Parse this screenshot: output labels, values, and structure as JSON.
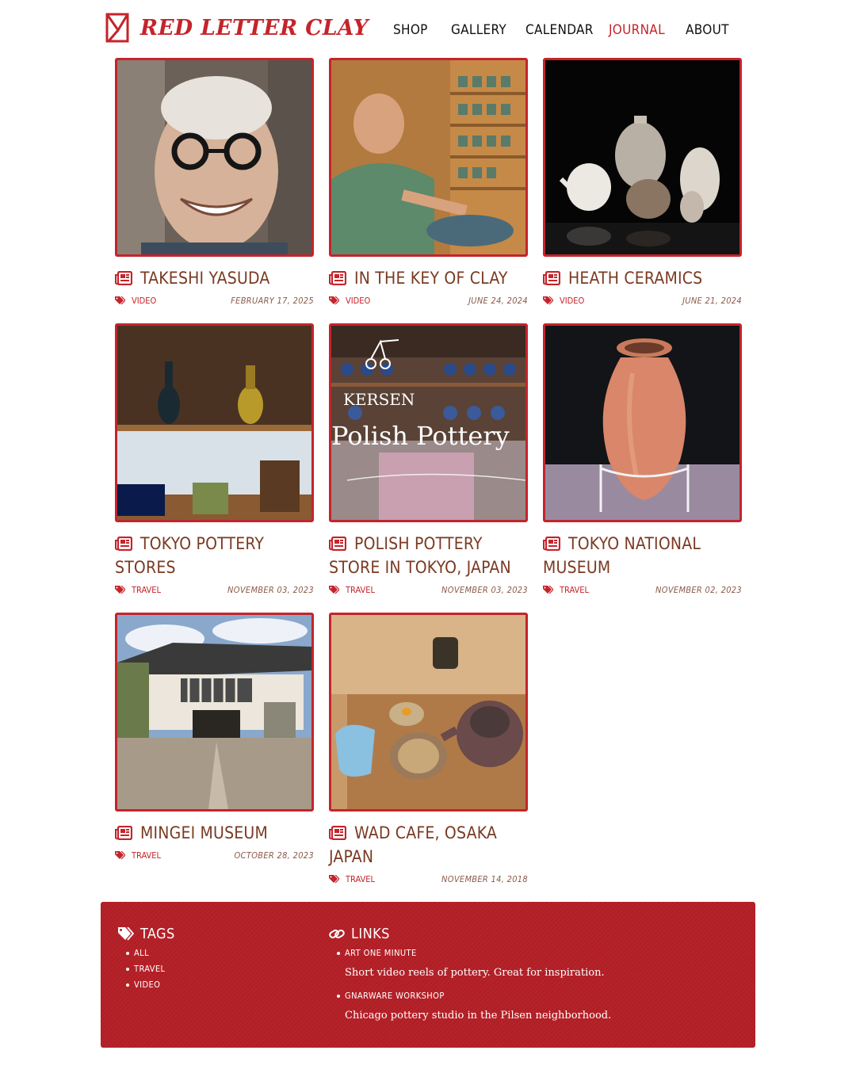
{
  "site": {
    "name": "RED LETTER CLAY"
  },
  "nav": [
    {
      "label": "SHOP"
    },
    {
      "label": "GALLERY"
    },
    {
      "label": "CALENDAR"
    },
    {
      "label": "JOURNAL",
      "active": true
    },
    {
      "label": "ABOUT"
    }
  ],
  "posts": [
    {
      "title": "TAKESHI YASUDA",
      "tag": "VIDEO",
      "date": "FEBRUARY 17, 2025",
      "image": "portrait of smiling man with round glasses"
    },
    {
      "title": "IN THE KEY OF CLAY",
      "tag": "VIDEO",
      "date": "JUNE 24, 2024",
      "image": "man arranging pottery on shelves"
    },
    {
      "title": "HEATH CERAMICS",
      "tag": "VIDEO",
      "date": "JUNE 21, 2024",
      "image": "ceramic teapots and pitchers on black"
    },
    {
      "title": "TOKYO POTTERY STORES",
      "tag": "TRAVEL",
      "date": "NOVEMBER 03, 2023",
      "image": "glazed vases and boxes on wooden shelves"
    },
    {
      "title": "POLISH POTTERY STORE IN TOKYO, JAPAN",
      "tag": "TRAVEL",
      "date": "NOVEMBER 03, 2023",
      "image": "shop window with Kersen Polish Pottery lettering"
    },
    {
      "title": "TOKYO NATIONAL MUSEUM",
      "tag": "TRAVEL",
      "date": "NOVEMBER 02, 2023",
      "image": "terracotta jar on a stand"
    },
    {
      "title": "MINGEI MUSEUM",
      "tag": "TRAVEL",
      "date": "OCTOBER 28, 2023",
      "image": "traditional japanese building entrance"
    },
    {
      "title": "WAD CAFE, OSAKA JAPAN",
      "tag": "TRAVEL",
      "date": "NOVEMBER 14, 2018",
      "image": "tea set on wooden table"
    }
  ],
  "footer": {
    "tags_heading": "TAGS",
    "tags": [
      "ALL",
      "TRAVEL",
      "VIDEO"
    ],
    "links_heading": "LINKS",
    "links": [
      {
        "label": "ART ONE MINUTE",
        "desc": "Short video reels of pottery. Great for inspiration."
      },
      {
        "label": "GNARWARE WORKSHOP",
        "desc": "Chicago pottery studio in the Pilsen neighborhood."
      }
    ]
  },
  "colors": {
    "brand_red": "#c4242b",
    "title_brown": "#7a3a22",
    "footer_red": "#b41f26"
  },
  "icons": {
    "post_title": "newspaper-icon",
    "post_tag": "tags-icon",
    "footer_tags": "tags-icon",
    "footer_links": "link-icon"
  }
}
